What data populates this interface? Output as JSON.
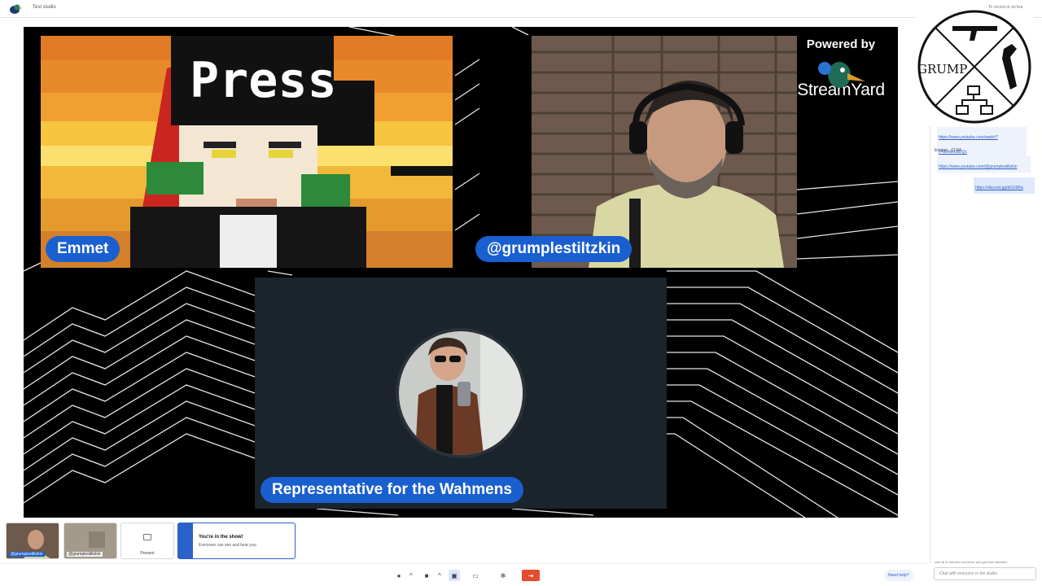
{
  "header": {
    "studio_title": "Test studio",
    "record_hint": "To record or go live"
  },
  "stage": {
    "participants": [
      {
        "name": "Emmet"
      },
      {
        "name": "@grumplestiltzkin"
      },
      {
        "name": "Representative for the Wahmens"
      }
    ],
    "overlay": {
      "powered_by": "Powered by",
      "brand": "StreamYard"
    },
    "emmet_tile_text": "Press",
    "grump_logo_text": "GRUMP"
  },
  "chat": {
    "link1": "https://www.youtube.com/watch?v=bkmmcBDQc",
    "author": "Emmet",
    "time": "07:04",
    "link2": "https://www.youtube.com/@grumplestiltzkin",
    "link3": "https://discord.gg/dGX9Rq",
    "tip": "Use @ to mention someone and get their attention",
    "input_placeholder": "Chat with everyone in the studio"
  },
  "thumbnails": [
    {
      "label": "@grumplestiltzkin"
    },
    {
      "label": "@grumplestiltzkin"
    }
  ],
  "present": {
    "label": "Present"
  },
  "banner": {
    "title": "You're in the show!",
    "subtitle": "Everyone can see and hear you"
  },
  "toolbar": {
    "help_label": "Need help?",
    "icons": [
      "mic-icon",
      "chevron-up-icon",
      "camera-icon",
      "chevron-up-icon",
      "layout-icon",
      "share-screen-icon",
      "settings-icon",
      "leave-icon"
    ]
  }
}
